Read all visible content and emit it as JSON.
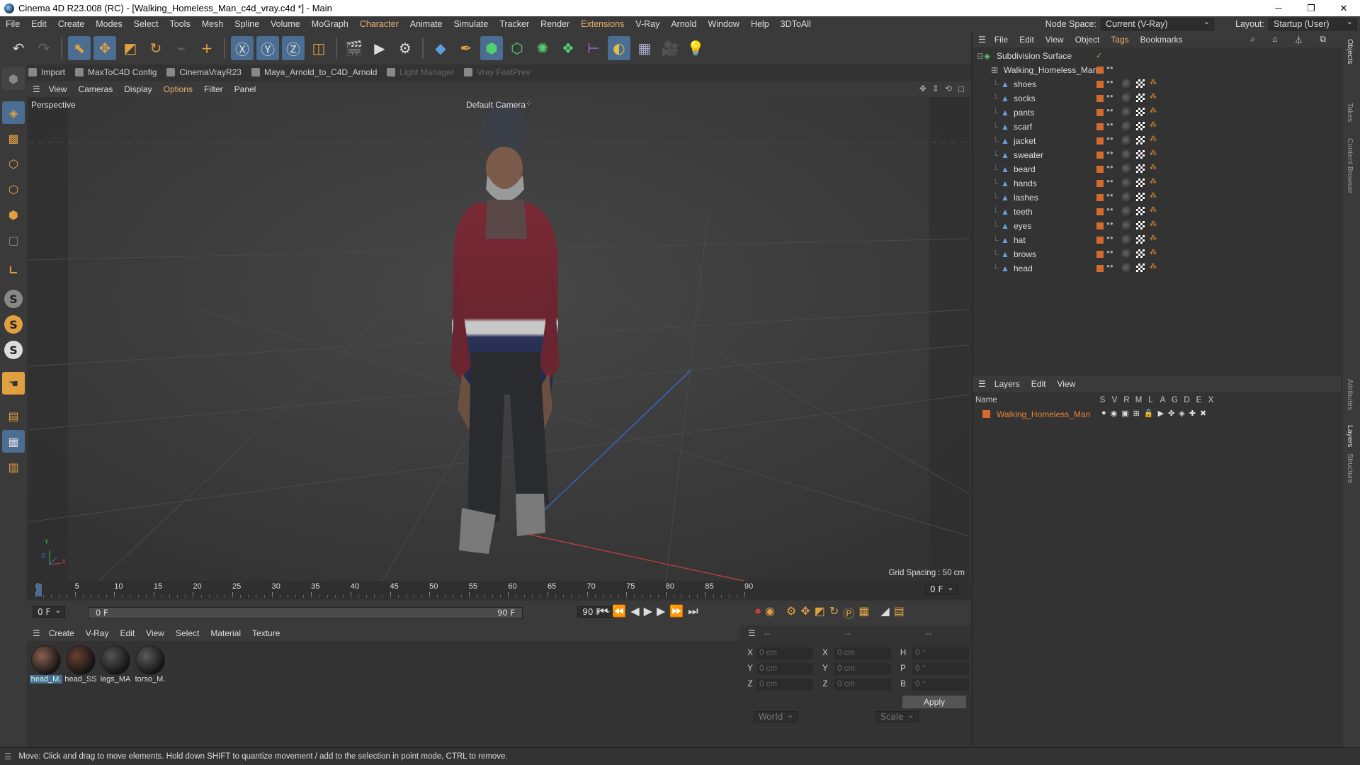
{
  "window": {
    "title": "Cinema 4D R23.008 (RC) - [Walking_Homeless_Man_c4d_vray.c4d *] - Main",
    "minimize": "─",
    "restore": "❐",
    "close": "✕"
  },
  "menu": [
    "File",
    "Edit",
    "Create",
    "Modes",
    "Select",
    "Tools",
    "Mesh",
    "Spline",
    "Volume",
    "MoGraph",
    "Character",
    "Animate",
    "Simulate",
    "Tracker",
    "Render",
    "Extensions",
    "V-Ray",
    "Arnold",
    "Window",
    "Help",
    "3DToAll"
  ],
  "menu_highlight": [
    "Character",
    "Extensions"
  ],
  "node_space": {
    "label": "Node Space:",
    "value": "Current (V-Ray)"
  },
  "layout": {
    "label": "Layout:",
    "value": "Startup (User)"
  },
  "plugins": [
    {
      "label": "Import",
      "dim": false
    },
    {
      "label": "MaxToC4D Config",
      "dim": false
    },
    {
      "label": "CinemaVrayR23",
      "dim": false
    },
    {
      "label": "Maya_Arnold_to_C4D_Arnold",
      "dim": false
    },
    {
      "label": "Light Manager",
      "dim": true
    },
    {
      "label": "Vray FastPrev",
      "dim": true
    }
  ],
  "viewport_menu": [
    "View",
    "Cameras",
    "Display",
    "Options",
    "Filter",
    "Panel"
  ],
  "viewport": {
    "label": "Perspective",
    "camera": "Default Camera",
    "grid_spacing": "Grid Spacing : 50 cm",
    "axis_y": "Y",
    "axis_z": "Z",
    "axis_x": "X"
  },
  "timeline": {
    "ticks": [
      "0",
      "5",
      "10",
      "15",
      "20",
      "25",
      "30",
      "35",
      "40",
      "45",
      "50",
      "55",
      "60",
      "65",
      "70",
      "75",
      "80",
      "85",
      "90"
    ],
    "current_frame": "0 F",
    "end_display": "0 F"
  },
  "controls": {
    "start_frame": "0 F",
    "range_start": "0 F",
    "range_end": "90 F",
    "end_frame": "90 F"
  },
  "material_menu": [
    "Create",
    "V-Ray",
    "Edit",
    "View",
    "Select",
    "Material",
    "Texture"
  ],
  "materials": [
    {
      "name": "head_M.",
      "selected": true
    },
    {
      "name": "head_SS",
      "selected": false
    },
    {
      "name": "legs_MA",
      "selected": false
    },
    {
      "name": "torso_M.",
      "selected": false
    }
  ],
  "coords": {
    "header": [
      "--",
      "--",
      "--"
    ],
    "rows": [
      {
        "a": "X",
        "av": "0 cm",
        "b": "X",
        "bv": "0 cm",
        "c": "H",
        "cv": "0 °"
      },
      {
        "a": "Y",
        "av": "0 cm",
        "b": "Y",
        "bv": "0 cm",
        "c": "P",
        "cv": "0 °"
      },
      {
        "a": "Z",
        "av": "0 cm",
        "b": "Z",
        "bv": "0 cm",
        "c": "B",
        "cv": "0 °"
      }
    ],
    "world": "World",
    "scale": "Scale",
    "apply": "Apply"
  },
  "object_menu": [
    "File",
    "Edit",
    "View",
    "Object",
    "Tags",
    "Bookmarks"
  ],
  "objects": {
    "root": "Subdivision Surface",
    "group": "Walking_Homeless_Man",
    "children": [
      "shoes",
      "socks",
      "pants",
      "scarf",
      "jacket",
      "sweater",
      "beard",
      "hands",
      "lashes",
      "teeth",
      "eyes",
      "hat",
      "brows",
      "head"
    ]
  },
  "layers_menu": [
    "Layers",
    "Edit",
    "View"
  ],
  "layers_header": {
    "name": "Name",
    "flags": [
      "S",
      "V",
      "R",
      "M",
      "L",
      "A",
      "G",
      "D",
      "E",
      "X"
    ]
  },
  "layers": [
    {
      "name": "Walking_Homeless_Man"
    }
  ],
  "right_tabs": [
    "Objects",
    "Takes",
    "Content Browser",
    "Attributes",
    "Layers",
    "Structure"
  ],
  "status": "Move: Click and drag to move elements. Hold down SHIFT to quantize movement / add to the selection in point mode, CTRL to remove.",
  "colors": {
    "accent": "#e8b070",
    "layer": "#d46a2c",
    "selected_blue": "#4a6d91"
  }
}
